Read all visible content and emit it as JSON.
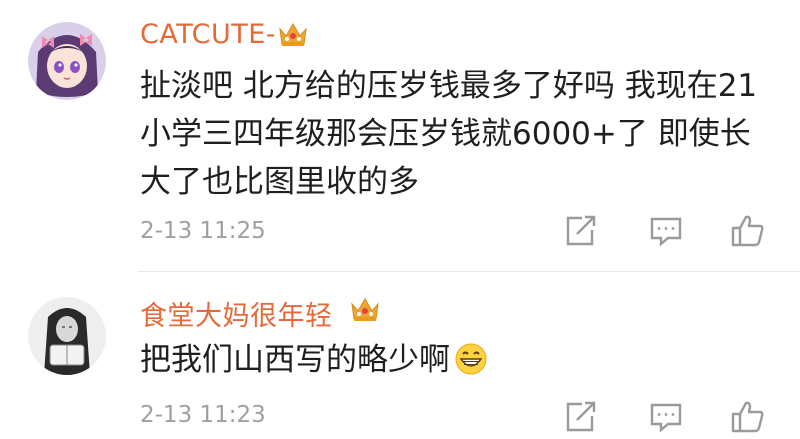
{
  "comments": [
    {
      "username": "CATCUTE-",
      "badge_icon": "crown-badge-icon",
      "content": "扯淡吧 北方给的压岁钱最多了好吗 我现在21 小学三四年级那会压岁钱就6000+了 即使长大了也比图里收的多",
      "timestamp": "2-13 11:25",
      "actions": [
        "forward-icon",
        "comment-icon",
        "like-icon"
      ]
    },
    {
      "username": "食堂大妈很年轻",
      "badge_icon": "crown-badge-icon",
      "content": "把我们山西写的略少啊",
      "emoji": "grin-emoji-icon",
      "timestamp": "2-13 11:23",
      "actions": [
        "forward-icon",
        "comment-icon",
        "like-icon"
      ]
    }
  ],
  "colors": {
    "username": "#e36a3b",
    "content": "#1f1f1f",
    "timestamp": "#a0a0a0",
    "icon": "#9a9a9a",
    "crown": "#f0a531"
  }
}
